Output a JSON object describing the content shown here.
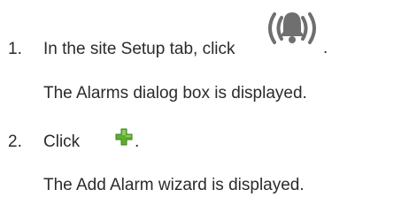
{
  "steps": [
    {
      "number": "1.",
      "instruction_prefix": "In the site Setup tab, click",
      "icon": "alarm-bell-icon",
      "instruction_suffix": ".",
      "result": "The Alarms dialog box is displayed."
    },
    {
      "number": "2.",
      "instruction_prefix": "Click",
      "icon": "green-plus-icon",
      "instruction_suffix": ".",
      "result": "The Add Alarm wizard is displayed."
    }
  ],
  "colors": {
    "text": "#2b2b2b",
    "icon_gray": "#6f6f6f",
    "plus_green": "#5fae2f"
  }
}
